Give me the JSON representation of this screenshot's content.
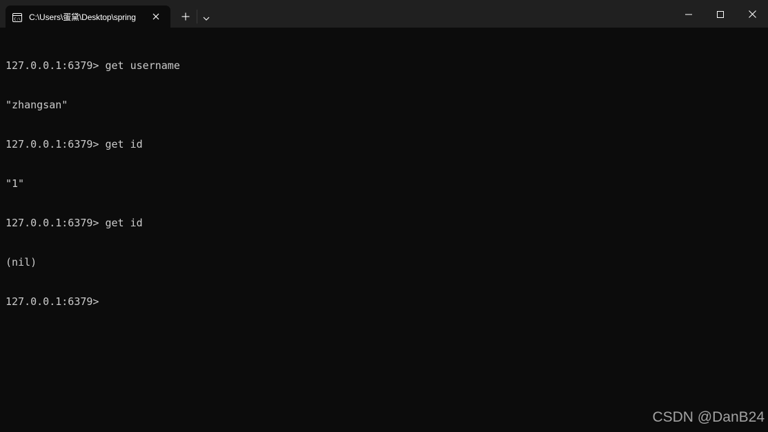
{
  "tab": {
    "title": "C:\\Users\\蛋黛\\Desktop\\spring",
    "icon": "console-icon"
  },
  "tabbar": {
    "new_tab_icon": "plus-icon",
    "dropdown_icon": "chevron-down-icon"
  },
  "window_controls": {
    "minimize_icon": "minimize-icon",
    "maximize_icon": "maximize-icon",
    "close_icon": "close-icon"
  },
  "terminal": {
    "lines": [
      "127.0.0.1:6379> get username",
      "\"zhangsan\"",
      "127.0.0.1:6379> get id",
      "\"1\"",
      "127.0.0.1:6379> get id",
      "(nil)",
      "127.0.0.1:6379> "
    ]
  },
  "watermark": "CSDN @DanB24",
  "colors": {
    "background": "#0c0c0c",
    "titlebar": "#202020",
    "text": "#cccccc"
  }
}
